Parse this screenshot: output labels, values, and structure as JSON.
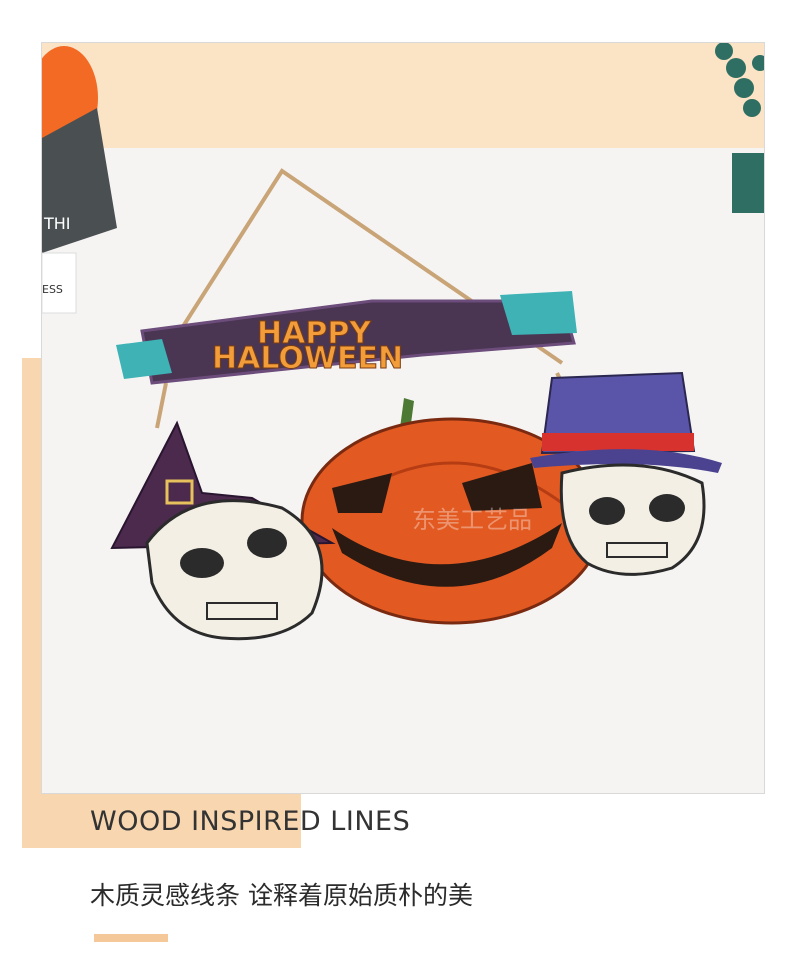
{
  "photo": {
    "sign_text_line1": "HAPPY",
    "sign_text_line2": "HALOWEEN",
    "book_spine_text_1": "THI",
    "book_spine_text_2": "ESS",
    "watermark": "东美工艺品"
  },
  "caption": {
    "english": "WOOD INSPIRED LINES",
    "chinese": "木质灵感线条  诠释着原始质朴的美"
  },
  "colors": {
    "accent_block": "#f7d6b0",
    "bottom_bar": "#f5c89a",
    "sign_board": "#4a3552",
    "pumpkin": "#e25a22",
    "witch_hat": "#4b2a4d",
    "top_hat": "#5a55a8",
    "hat_band": "#d8322f"
  },
  "icons": [
    "halloween-sign-image",
    "pumpkin-image",
    "skull-image",
    "witch-hat-image",
    "top-hat-image"
  ]
}
